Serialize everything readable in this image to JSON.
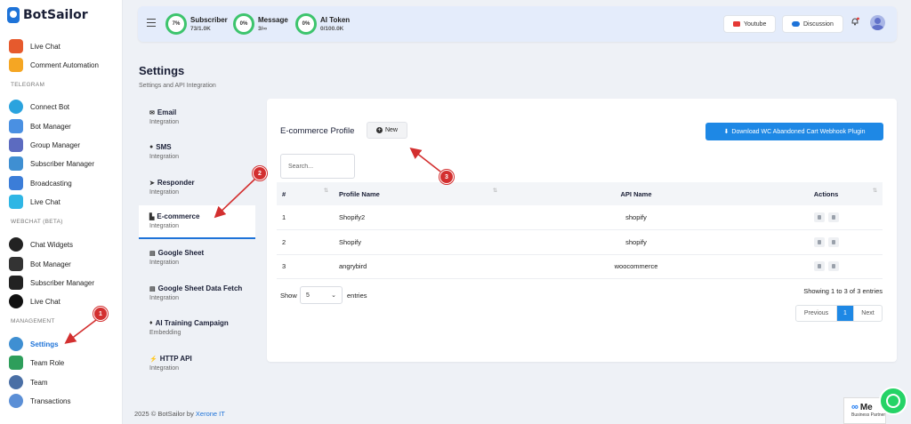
{
  "brand": {
    "name": "BotSailor"
  },
  "sidebar": {
    "items_top": [
      {
        "label": "Live Chat",
        "icon": "live-chat-icon",
        "color": "#e65a2d"
      },
      {
        "label": "Comment Automation",
        "icon": "comment-automation-icon",
        "color": "#f5a623"
      }
    ],
    "telegram_title": "TELEGRAM",
    "telegram": [
      {
        "label": "Connect Bot",
        "icon": "telegram-icon",
        "color": "#2aa3de"
      },
      {
        "label": "Bot Manager",
        "icon": "bot-manager-icon",
        "color": "#4a90e2"
      },
      {
        "label": "Group Manager",
        "icon": "group-manager-icon",
        "color": "#5c6bc0"
      },
      {
        "label": "Subscriber Manager",
        "icon": "subscriber-manager-icon",
        "color": "#3f8fd2"
      },
      {
        "label": "Broadcasting",
        "icon": "broadcasting-icon",
        "color": "#3b7dd8"
      },
      {
        "label": "Live Chat",
        "icon": "live-chat-icon",
        "color": "#2fb6e5"
      }
    ],
    "webchat_title": "WEBCHAT (BETA)",
    "webchat": [
      {
        "label": "Chat Widgets",
        "icon": "chat-widgets-icon",
        "color": "#222222"
      },
      {
        "label": "Bot Manager",
        "icon": "bot-manager-icon",
        "color": "#333333"
      },
      {
        "label": "Subscriber Manager",
        "icon": "subscriber-manager-icon",
        "color": "#222222"
      },
      {
        "label": "Live Chat",
        "icon": "live-chat-icon",
        "color": "#111111"
      }
    ],
    "management_title": "MANAGEMENT",
    "management": [
      {
        "label": "Settings",
        "icon": "settings-icon",
        "color": "#3f8fd2",
        "active": true
      },
      {
        "label": "Team Role",
        "icon": "team-role-icon",
        "color": "#2e9e5b"
      },
      {
        "label": "Team",
        "icon": "team-icon",
        "color": "#4a6fa5"
      },
      {
        "label": "Transactions",
        "icon": "transactions-icon",
        "color": "#5b8fd6"
      }
    ]
  },
  "topbar": {
    "stats": [
      {
        "percent": "7%",
        "title": "Subscriber",
        "sub": "73/1.0K"
      },
      {
        "percent": "0%",
        "title": "Message",
        "sub": "3/∞"
      },
      {
        "percent": "0%",
        "title": "AI Token",
        "sub": "0/100.0K"
      }
    ],
    "youtube_label": "Youtube",
    "discussion_label": "Discussion"
  },
  "page": {
    "title": "Settings",
    "subtitle": "Settings and API Integration"
  },
  "settings_nav": [
    {
      "title": "Email",
      "sub": "Integration",
      "glyph": "✉"
    },
    {
      "title": "SMS",
      "sub": "Integration",
      "glyph": "●"
    },
    {
      "title": "Responder",
      "sub": "Integration",
      "glyph": "➤"
    },
    {
      "title": "E-commerce",
      "sub": "Integration",
      "glyph": "🛒",
      "active": true
    },
    {
      "title": "Google Sheet",
      "sub": "Integration",
      "glyph": "▤"
    },
    {
      "title": "Google Sheet Data Fetch",
      "sub": "Integration",
      "glyph": "▤"
    },
    {
      "title": "AI Training Campaign",
      "sub": "Embedding",
      "glyph": "♦"
    },
    {
      "title": "HTTP API",
      "sub": "Integration",
      "glyph": "⚡"
    }
  ],
  "card": {
    "title": "E-commerce Profile",
    "new_label": "New",
    "download_label": "Download WC Abandoned Cart Webhook Plugin",
    "search_placeholder": "Search...",
    "columns": [
      "#",
      "Profile Name",
      "API Name",
      "Actions"
    ],
    "rows": [
      {
        "num": "1",
        "name": "Shopify2",
        "api": "shopify"
      },
      {
        "num": "2",
        "name": "Shopify",
        "api": "shopify"
      },
      {
        "num": "3",
        "name": "angrybird",
        "api": "woocommerce"
      }
    ],
    "show_label": "Show",
    "entries_value": "5",
    "entries_label": "entries",
    "showing": "Showing 1 to 3 of 3 entries",
    "pager": {
      "prev": "Previous",
      "current": "1",
      "next": "Next"
    }
  },
  "annotations": [
    "1",
    "2",
    "3"
  ],
  "footer": {
    "text": "2025 © BotSailor by ",
    "link": "Xerone IT"
  },
  "meta_badge": {
    "main": "Me",
    "sub": "Business Partner"
  },
  "colors": {
    "accent": "#1e88e5",
    "ring": "#3dc46d",
    "marker": "#d32f2f"
  }
}
